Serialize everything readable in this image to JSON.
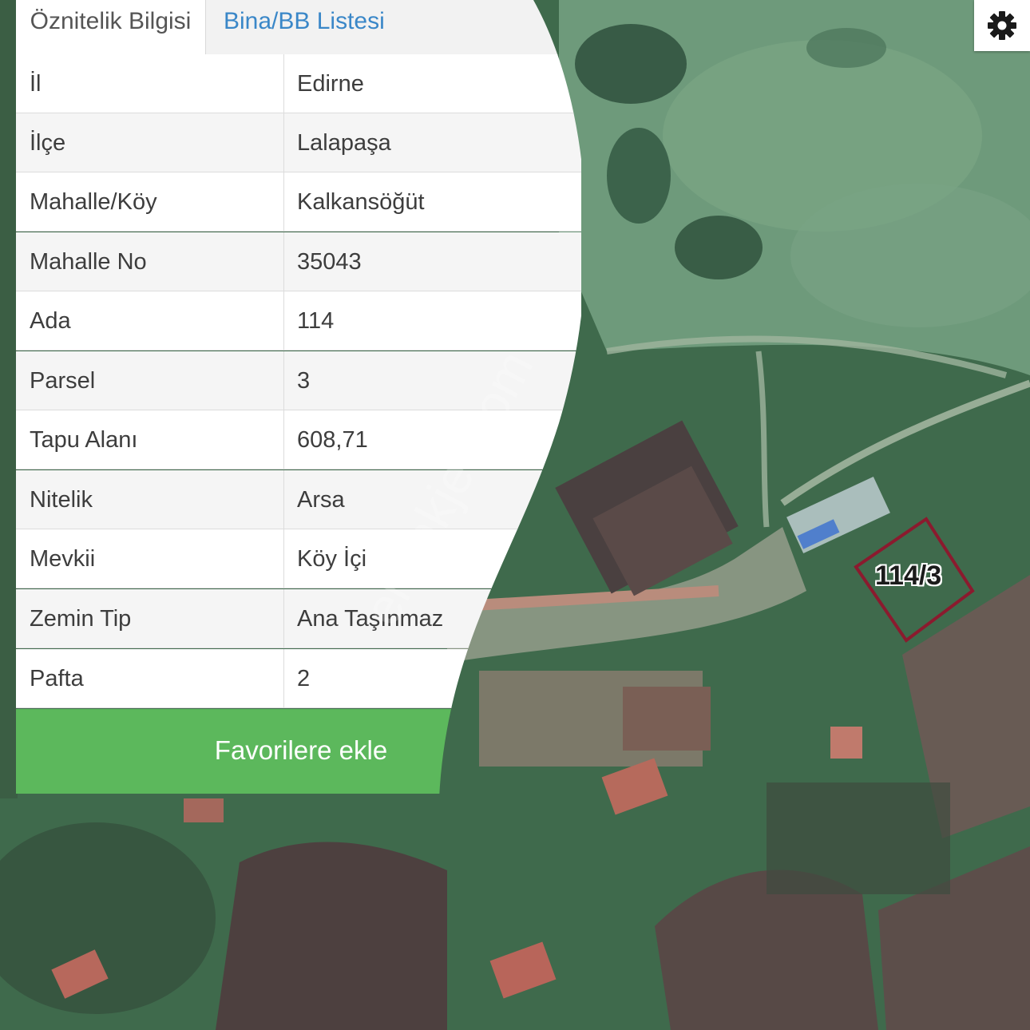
{
  "tabs": [
    {
      "label": "Öznitelik Bilgisi",
      "active": true
    },
    {
      "label": "Bina/BB Listesi",
      "active": false
    }
  ],
  "attributes": [
    {
      "label": "İl",
      "value": "Edirne"
    },
    {
      "label": "İlçe",
      "value": "Lalapaşa"
    },
    {
      "label": "Mahalle/Köy",
      "value": "Kalkansöğüt"
    },
    {
      "label": "Mahalle No",
      "value": "35043"
    },
    {
      "label": "Ada",
      "value": "114"
    },
    {
      "label": "Parsel",
      "value": "3"
    },
    {
      "label": "Tapu Alanı",
      "value": "608,71"
    },
    {
      "label": "Nitelik",
      "value": "Arsa"
    },
    {
      "label": "Mevkii",
      "value": "Köy İçi"
    },
    {
      "label": "Zemin Tip",
      "value": "Ana Taşınmaz"
    },
    {
      "label": "Pafta",
      "value": "2"
    }
  ],
  "favorite_button": {
    "label": "Favorilere ekle"
  },
  "map": {
    "parcel_label": "114/3",
    "watermark": "emlakjet.com"
  },
  "settings": {
    "icon": "gear-icon"
  },
  "colors": {
    "tab_link": "#3a87c8",
    "favorite_button": "#5cb85c",
    "parcel_outline": "#8b1a2e"
  }
}
